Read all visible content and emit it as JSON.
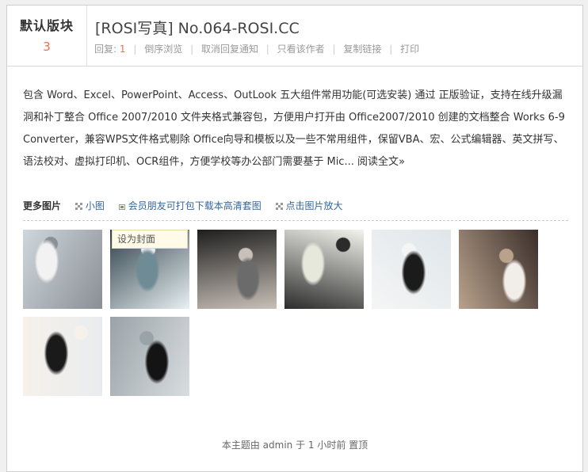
{
  "forum": {
    "name": "默认版块",
    "count": "3"
  },
  "thread": {
    "title": "[ROSI写真] No.064-ROSI.CC"
  },
  "actions": {
    "reply_label": "回复:",
    "reply_count": "1",
    "items": [
      "倒序浏览",
      "取消回复通知",
      "只看该作者",
      "复制链接",
      "打印"
    ]
  },
  "description": {
    "text": "包含 Word、Excel、PowerPoint、Access、OutLook 五大组件常用功能(可选安装) 通过 正版验证，支持在线升级漏洞和补丁整合 Office 2007/2010 文件夹格式兼容包，方便用户打开由 Office2007/2010 创建的文档整合 Works 6-9 Converter，兼容WPS文件格式剔除 Office向导和模板以及一些不常用组件，保留VBA、宏、公式编辑器、英文拼写、语法校对、虚拟打印机、OCR组件，方便学校等办公部门需要基于 Mic...",
    "more": "阅读全文»"
  },
  "image_bar": {
    "heading": "更多图片",
    "small_label": "小图",
    "download_label": "会员朋友可打包下载本高清套图",
    "zoom_label": "点击图片放大"
  },
  "tooltip": {
    "set_cover": "设为封面"
  },
  "thumbnails": [
    {
      "palette": [
        "#cfd6dc",
        "#f2f2f2",
        "#8a8f96"
      ]
    },
    {
      "palette": [
        "#2e4049",
        "#6f8b95",
        "#e8f0f3"
      ]
    },
    {
      "palette": [
        "#1e1e1e",
        "#6b6b6b",
        "#c8c0b8"
      ]
    },
    {
      "palette": [
        "#f4f4ee",
        "#e6e8dc",
        "#2b2b2b"
      ]
    },
    {
      "palette": [
        "#dfe6ea",
        "#1b1b1b",
        "#f5f5f5"
      ]
    },
    {
      "palette": [
        "#3a2e2a",
        "#f1ede8",
        "#b9a28c"
      ]
    },
    {
      "palette": [
        "#e9ecef",
        "#1a1a1a",
        "#f6f1ea"
      ]
    },
    {
      "palette": [
        "#d9dde0",
        "#141414",
        "#9aa3a8"
      ]
    }
  ],
  "footer": {
    "text": "本主题由 admin 于 1 小时前 置顶"
  }
}
